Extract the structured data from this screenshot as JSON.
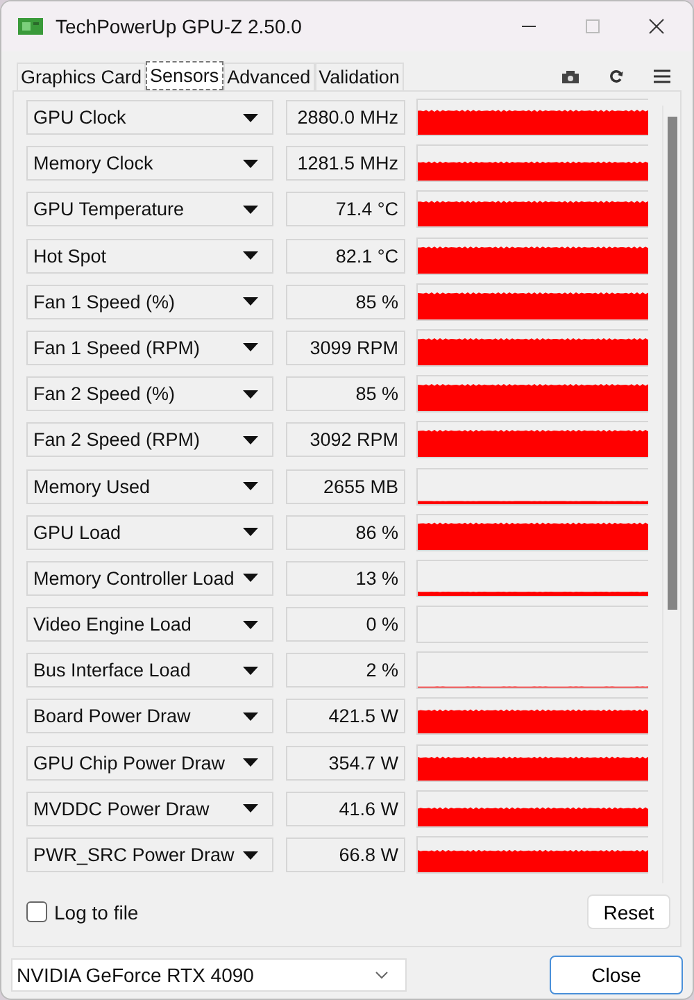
{
  "window": {
    "title": "TechPowerUp GPU-Z 2.50.0"
  },
  "tabs": [
    {
      "label": "Graphics Card",
      "selected": false
    },
    {
      "label": "Sensors",
      "selected": true
    },
    {
      "label": "Advanced",
      "selected": false
    },
    {
      "label": "Validation",
      "selected": false
    }
  ],
  "sensors": [
    {
      "name": "GPU Clock",
      "value": "2880.0 MHz"
    },
    {
      "name": "Memory Clock",
      "value": "1281.5 MHz"
    },
    {
      "name": "GPU Temperature",
      "value": "71.4 °C"
    },
    {
      "name": "Hot Spot",
      "value": "82.1 °C"
    },
    {
      "name": "Fan 1 Speed (%)",
      "value": "85 %"
    },
    {
      "name": "Fan 1 Speed (RPM)",
      "value": "3099 RPM"
    },
    {
      "name": "Fan 2 Speed (%)",
      "value": "85 %"
    },
    {
      "name": "Fan 2 Speed (RPM)",
      "value": "3092 RPM"
    },
    {
      "name": "Memory Used",
      "value": "2655 MB"
    },
    {
      "name": "GPU Load",
      "value": "86 %"
    },
    {
      "name": "Memory Controller Load",
      "value": "13 %"
    },
    {
      "name": "Video Engine Load",
      "value": "0 %"
    },
    {
      "name": "Bus Interface Load",
      "value": "2 %"
    },
    {
      "name": "Board Power Draw",
      "value": "421.5 W"
    },
    {
      "name": "GPU Chip Power Draw",
      "value": "354.7 W"
    },
    {
      "name": "MVDDC Power Draw",
      "value": "41.6 W"
    },
    {
      "name": "PWR_SRC Power Draw",
      "value": "66.8 W"
    }
  ],
  "log_to_file": {
    "label": "Log to file",
    "checked": false
  },
  "reset_button": "Reset",
  "gpu_select": "NVIDIA GeForce RTX 4090",
  "close_button": "Close"
}
